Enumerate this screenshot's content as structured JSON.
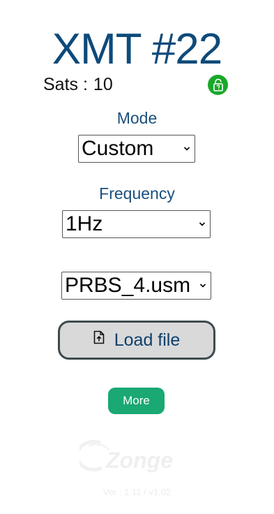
{
  "header": {
    "title": "XMT #22",
    "sats_label": "Sats :",
    "sats_value": "10",
    "lock_icon": "unlocked-padlock-icon",
    "lock_color": "#1aa82b"
  },
  "mode": {
    "label": "Mode",
    "selected": "Custom"
  },
  "frequency": {
    "label": "Frequency",
    "selected": "1Hz"
  },
  "file_select": {
    "selected": "PRBS_4.usm"
  },
  "load_button": {
    "label": "Load file",
    "icon": "file-upload-icon"
  },
  "more_button": {
    "label": "More",
    "color": "#1aa873"
  },
  "footer": {
    "logo_text": "Zonge",
    "version": "Ver : 1.11 / v1.02"
  }
}
